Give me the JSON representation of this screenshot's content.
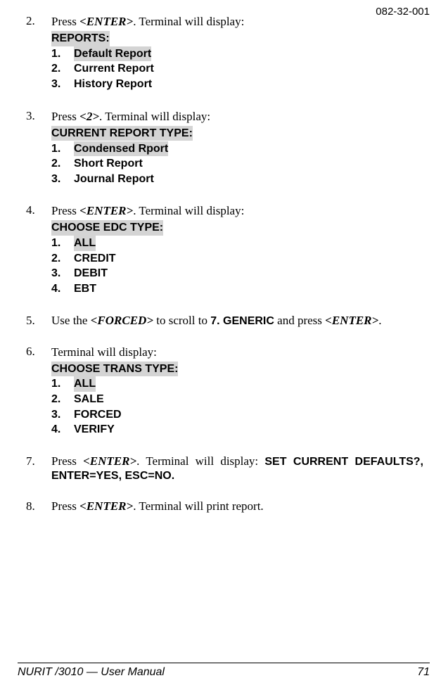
{
  "header": {
    "doc_number": "082-32-001"
  },
  "steps": {
    "s2": {
      "num": "2.",
      "text1": "Press ",
      "key1": "<ENTER>",
      "text2": ". Terminal will display:",
      "prompt": "REPORTS:",
      "items": [
        {
          "n": "1.",
          "label_hl": "Default Report"
        },
        {
          "n": "2.",
          "label": "Current Report"
        },
        {
          "n": "3.",
          "label": "History Report"
        }
      ]
    },
    "s3": {
      "num": "3.",
      "text1": "Press ",
      "key1": "<2>",
      "text2": ". Terminal will display:",
      "prompt": "CURRENT REPORT TYPE:",
      "items": [
        {
          "n": "1.",
          "label_hl": "Condensed Rport"
        },
        {
          "n": "2.",
          "label": "Short Report"
        },
        {
          "n": "3.",
          "label": "Journal Report"
        }
      ]
    },
    "s4": {
      "num": "4.",
      "text1": "Press ",
      "key1": "<ENTER>",
      "text2": ". Terminal will display:",
      "prompt": "CHOOSE EDC TYPE:",
      "items": [
        {
          "n": "1.",
          "label_hl": "ALL"
        },
        {
          "n": "2.",
          "label": "CREDIT"
        },
        {
          "n": "3.",
          "label": "DEBIT"
        },
        {
          "n": "4.",
          "label": "EBT"
        }
      ]
    },
    "s5": {
      "num": "5.",
      "text1": "Use the ",
      "key1": "<FORCED>",
      "text2": " to scroll to ",
      "bold1": "7. GENERIC",
      "text3": " and press ",
      "key2": "<ENTER>",
      "text4": "."
    },
    "s6": {
      "num": "6.",
      "text1": "Terminal will display:",
      "prompt": "CHOOSE TRANS TYPE:",
      "items": [
        {
          "n": "1.",
          "label_hl": "ALL"
        },
        {
          "n": "2.",
          "label": "SALE"
        },
        {
          "n": "3.",
          "label": "FORCED"
        },
        {
          "n": "4.",
          "label": "VERIFY"
        }
      ]
    },
    "s7": {
      "num": "7.",
      "text1": "Press ",
      "key1": "<ENTER>",
      "text2": ". Terminal will display: ",
      "bold1": "SET CURRENT DEFAULTS?, ENTER=YES, ESC=NO."
    },
    "s8": {
      "num": "8.",
      "text1": "Press ",
      "key1": "<ENTER>",
      "text2": ". Terminal will print report."
    }
  },
  "footer": {
    "left": "NURIT /3010 — User Manual",
    "right": "71"
  }
}
